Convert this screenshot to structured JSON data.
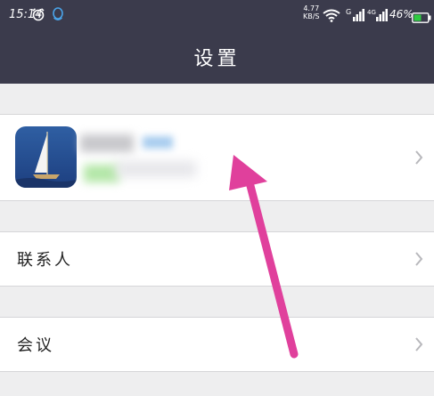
{
  "status_bar": {
    "time": "15:14",
    "speed_value": "4.77",
    "speed_unit": "KB/S",
    "signal_g": "G",
    "signal_4g": "4G",
    "battery": "46%"
  },
  "navbar": {
    "title": "设置"
  },
  "rows": {
    "contacts": {
      "label": "联系人"
    },
    "meeting": {
      "label": "会议"
    }
  },
  "icons": {
    "alarm": "alarm-icon",
    "qq": "qq-icon",
    "wifi": "wifi-icon",
    "signal": "signal-icon",
    "battery": "battery-icon",
    "chevron": "chevron-right-icon",
    "app": "sailboat-app-icon"
  },
  "colors": {
    "navbar": "#3b3b4c",
    "background": "#eeeeef",
    "arrow_annotation": "#e0409c",
    "battery_fill": "#2ecc40"
  }
}
